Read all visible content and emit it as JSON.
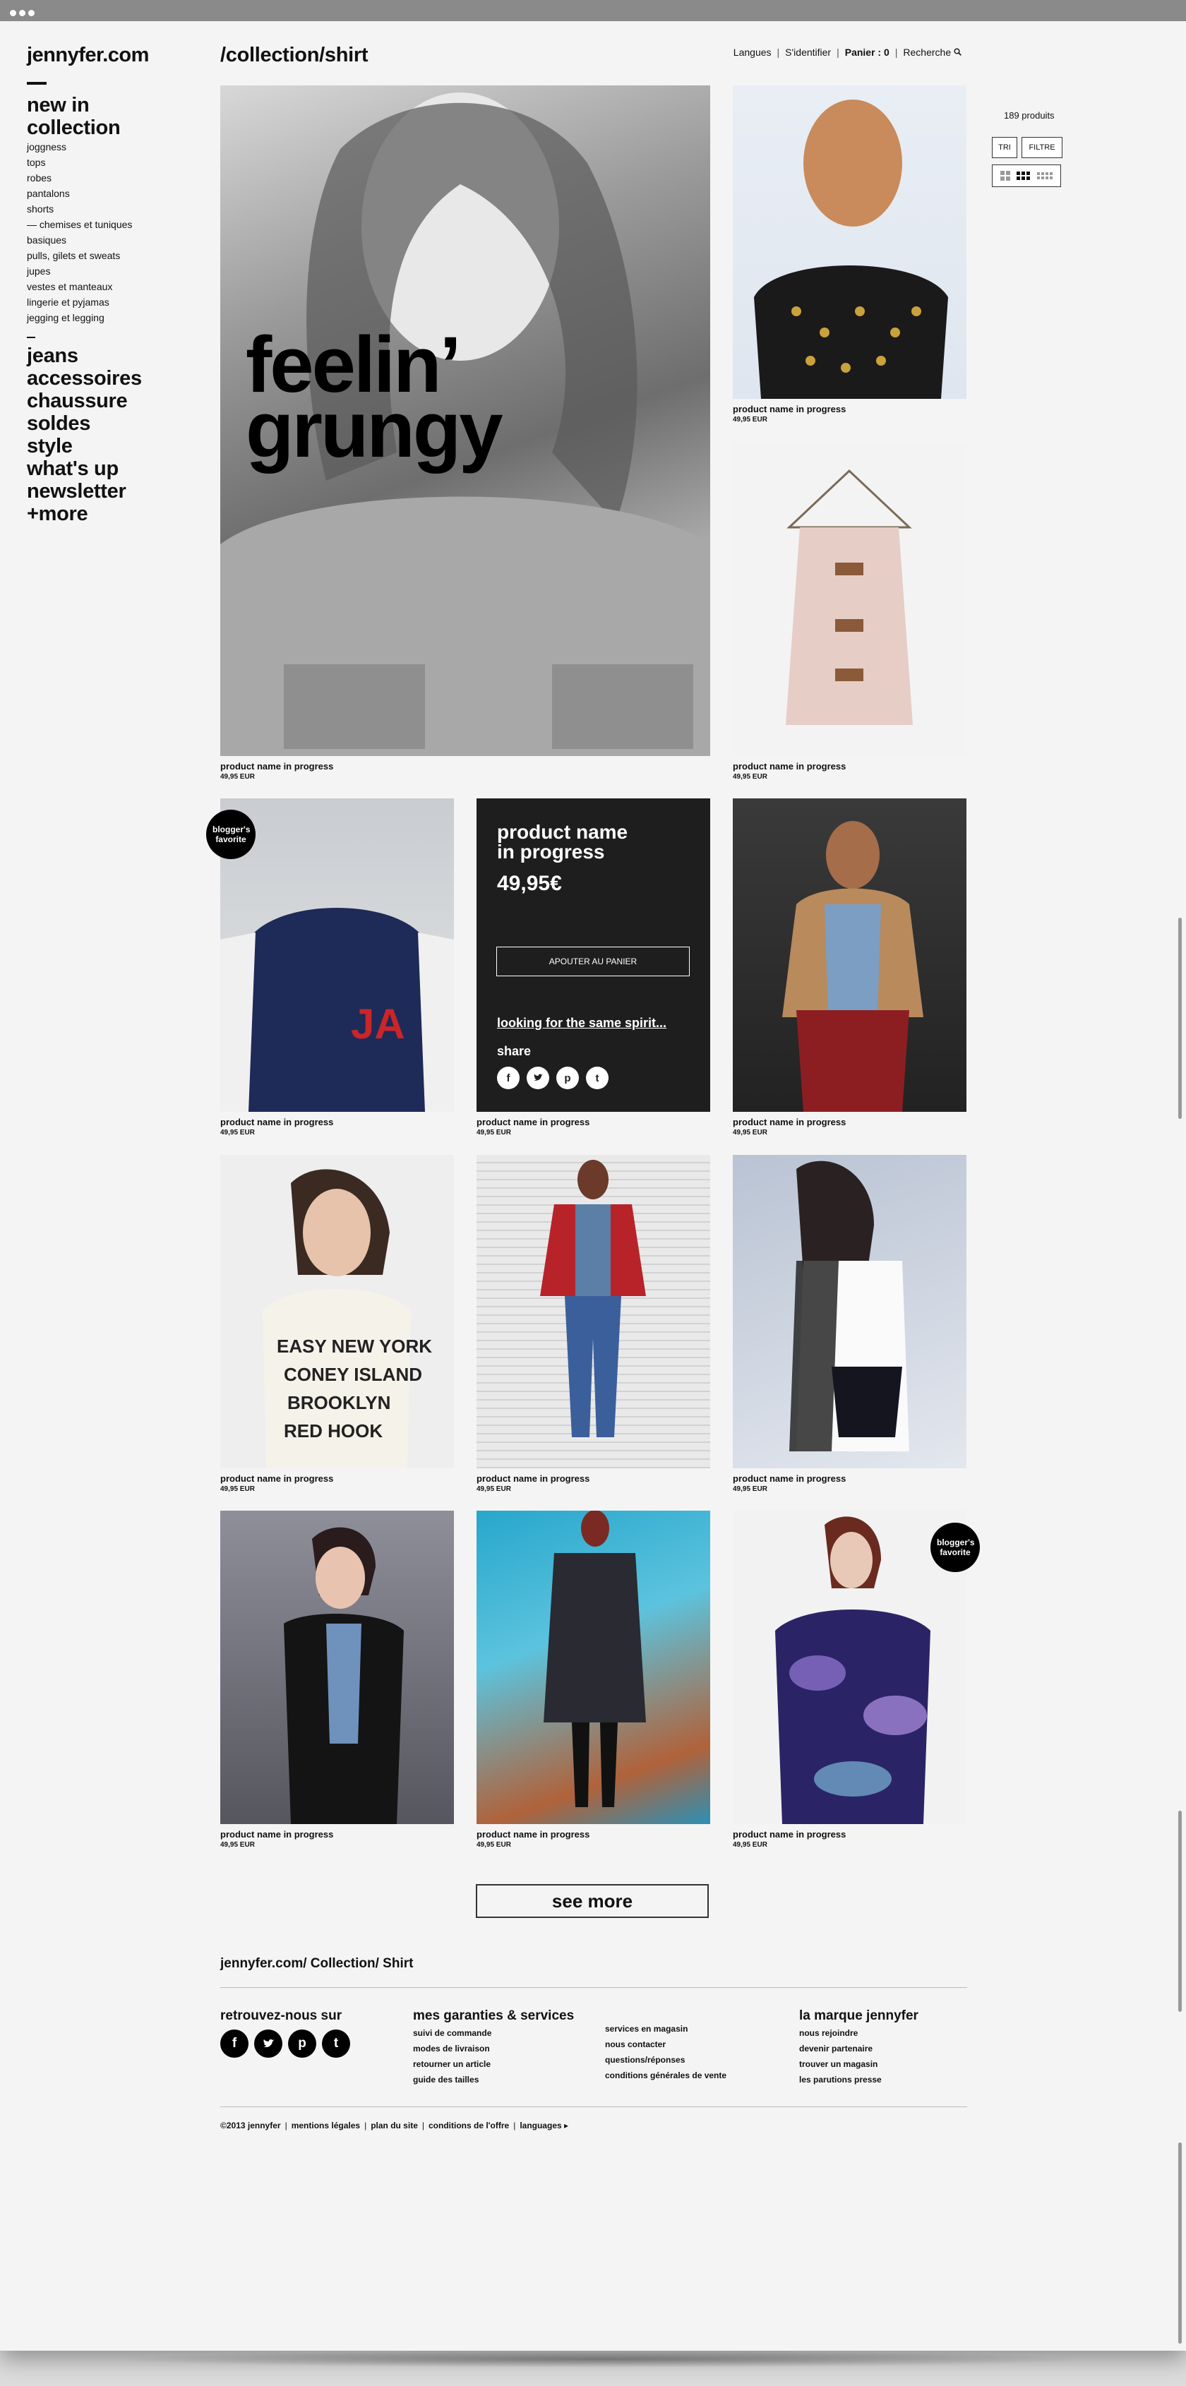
{
  "logo": "jennyfer.com",
  "sidebar": {
    "primary": [
      "new in",
      "collection"
    ],
    "sub": [
      "joggness",
      "tops",
      "robes",
      "pantalons",
      "shorts",
      "— chemises et tuniques",
      "basiques",
      "pulls, gilets et sweats",
      "jupes",
      "vestes et manteaux",
      "lingerie et pyjamas",
      "jegging et legging"
    ],
    "secondary": [
      "jeans",
      "accessoires",
      "chaussure",
      "soldes",
      "style",
      "what's up",
      "newsletter",
      "+more"
    ]
  },
  "header": {
    "breadcrumb": "/collection/shirt",
    "nav": {
      "langues": "Langues",
      "login": "S'identifier",
      "cart": "Panier : 0",
      "search": "Recherche"
    }
  },
  "filters": {
    "count": "189 produits",
    "sort": "TRI",
    "filter": "FILTRE"
  },
  "hero": {
    "line1": "feelin’",
    "line2": "grungy"
  },
  "product": {
    "name": "product name in progress",
    "price": "49,95 EUR"
  },
  "card": {
    "name": "product name\nin progress",
    "price": "49,95€",
    "add_to_cart": "APOUTER AU PANIER",
    "link": "looking for the same spirit...",
    "share": "share"
  },
  "badge": "blogger's favorite",
  "see_more": "see more",
  "footer": {
    "breadcrumb": "jennyfer.com/ Collection/ Shirt",
    "follow": "retrouvez-nous sur",
    "guarantees_title": "mes garanties & services",
    "guarantees_a": [
      "suivi de commande",
      "modes de livraison",
      "retourner un article",
      "guide des tailles"
    ],
    "guarantees_b": [
      "services en magasin",
      "nous contacter",
      "questions/réponses",
      "conditions générales de vente"
    ],
    "brand_title": "la marque jennyfer",
    "brand": [
      "nous rejoindre",
      "devenir partenaire",
      "trouver un magasin",
      "les parutions presse"
    ],
    "legal": [
      "©2013 jennyfer",
      "mentions légales",
      "plan du site",
      "conditions de l'offre",
      "languages ▸"
    ]
  }
}
